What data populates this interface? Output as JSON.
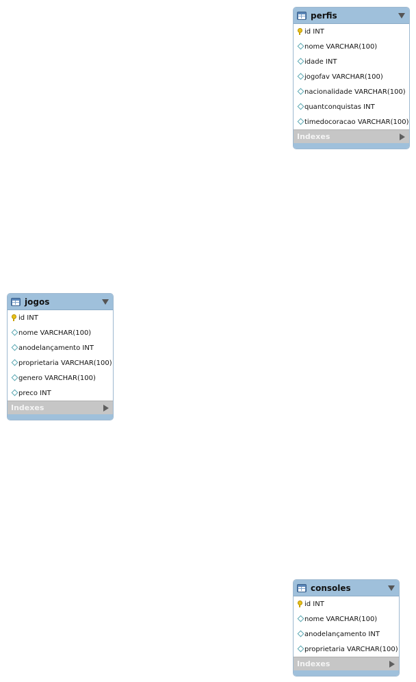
{
  "tables": {
    "perfis": {
      "name": "perfis",
      "indexes_label": "Indexes",
      "columns": [
        {
          "label": "id INT",
          "key": true
        },
        {
          "label": "nome VARCHAR(100)",
          "key": false
        },
        {
          "label": "idade INT",
          "key": false
        },
        {
          "label": "jogofav VARCHAR(100)",
          "key": false
        },
        {
          "label": "nacionalidade VARCHAR(100)",
          "key": false
        },
        {
          "label": "quantconquistas INT",
          "key": false
        },
        {
          "label": "timedocoracao VARCHAR(100)",
          "key": false
        }
      ]
    },
    "jogos": {
      "name": "jogos",
      "indexes_label": "Indexes",
      "columns": [
        {
          "label": "id INT",
          "key": true
        },
        {
          "label": "nome VARCHAR(100)",
          "key": false
        },
        {
          "label": "anodelançamento INT",
          "key": false
        },
        {
          "label": "proprietaria VARCHAR(100)",
          "key": false
        },
        {
          "label": "genero VARCHAR(100)",
          "key": false
        },
        {
          "label": "preco INT",
          "key": false
        }
      ]
    },
    "consoles": {
      "name": "consoles",
      "indexes_label": "Indexes",
      "columns": [
        {
          "label": "id INT",
          "key": true
        },
        {
          "label": "nome VARCHAR(100)",
          "key": false
        },
        {
          "label": "anodelançamento INT",
          "key": false
        },
        {
          "label": "proprietaria VARCHAR(100)",
          "key": false
        }
      ]
    }
  },
  "icons": {
    "table": "table-icon",
    "primary_key": "key-icon",
    "column": "diamond-icon",
    "collapse": "triangle-down-icon",
    "expand": "triangle-right-icon"
  },
  "colors": {
    "header": "#9fc0db",
    "indexes": "#c6c6c6",
    "key": "#e7c21c",
    "column_diamond": "#5aa7b2"
  }
}
